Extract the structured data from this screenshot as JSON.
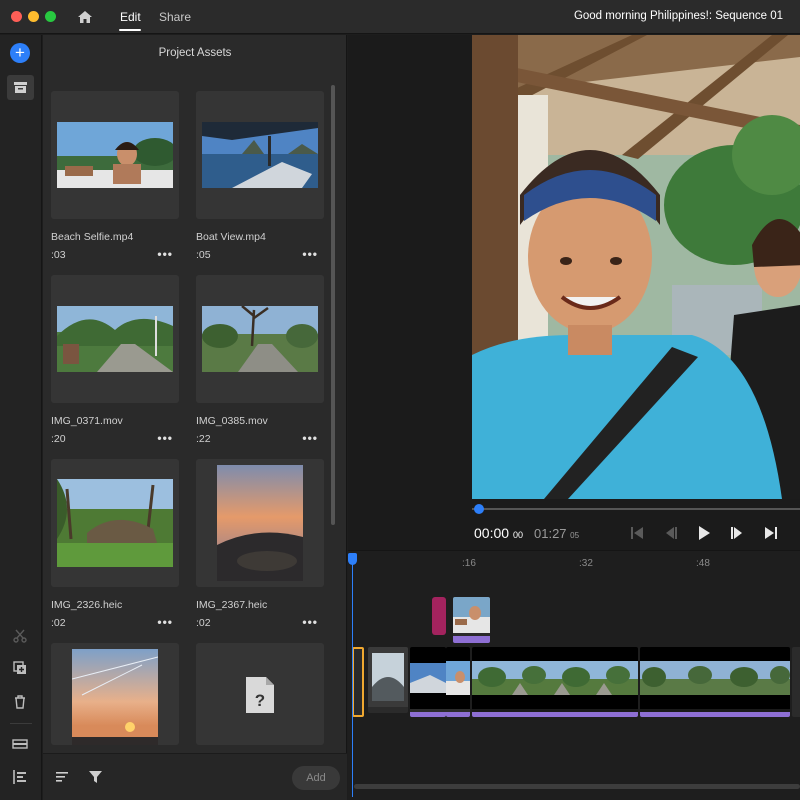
{
  "titlebar": {
    "tabs": [
      {
        "label": "Edit",
        "active": true
      },
      {
        "label": "Share",
        "active": false
      }
    ],
    "document_title": "Good morning Philippines!: Sequence 01"
  },
  "assets_panel": {
    "title": "Project Assets",
    "items": [
      {
        "name": "Beach Selfie.mp4",
        "duration": ":03"
      },
      {
        "name": "Boat View.mp4",
        "duration": ":05"
      },
      {
        "name": "IMG_0371.mov",
        "duration": ":20"
      },
      {
        "name": "IMG_0385.mov",
        "duration": ":22"
      },
      {
        "name": "IMG_2326.heic",
        "duration": ":02"
      },
      {
        "name": "IMG_2367.heic",
        "duration": ":02"
      },
      {
        "name": "",
        "duration": ""
      },
      {
        "name": "",
        "duration": ""
      }
    ],
    "more_label": "•••",
    "footer": {
      "add_label": "Add"
    }
  },
  "viewer": {
    "current_time": "00:00",
    "current_frames": "00",
    "total_time": "01:27",
    "total_frames": "05"
  },
  "timeline": {
    "ruler": [
      ":16",
      ":32",
      ":48"
    ]
  },
  "colors": {
    "accent": "#2d7ff9",
    "audio_strip": "#8e6fd4",
    "marker": "#a3235e",
    "selected_clip": "#f0a830"
  }
}
